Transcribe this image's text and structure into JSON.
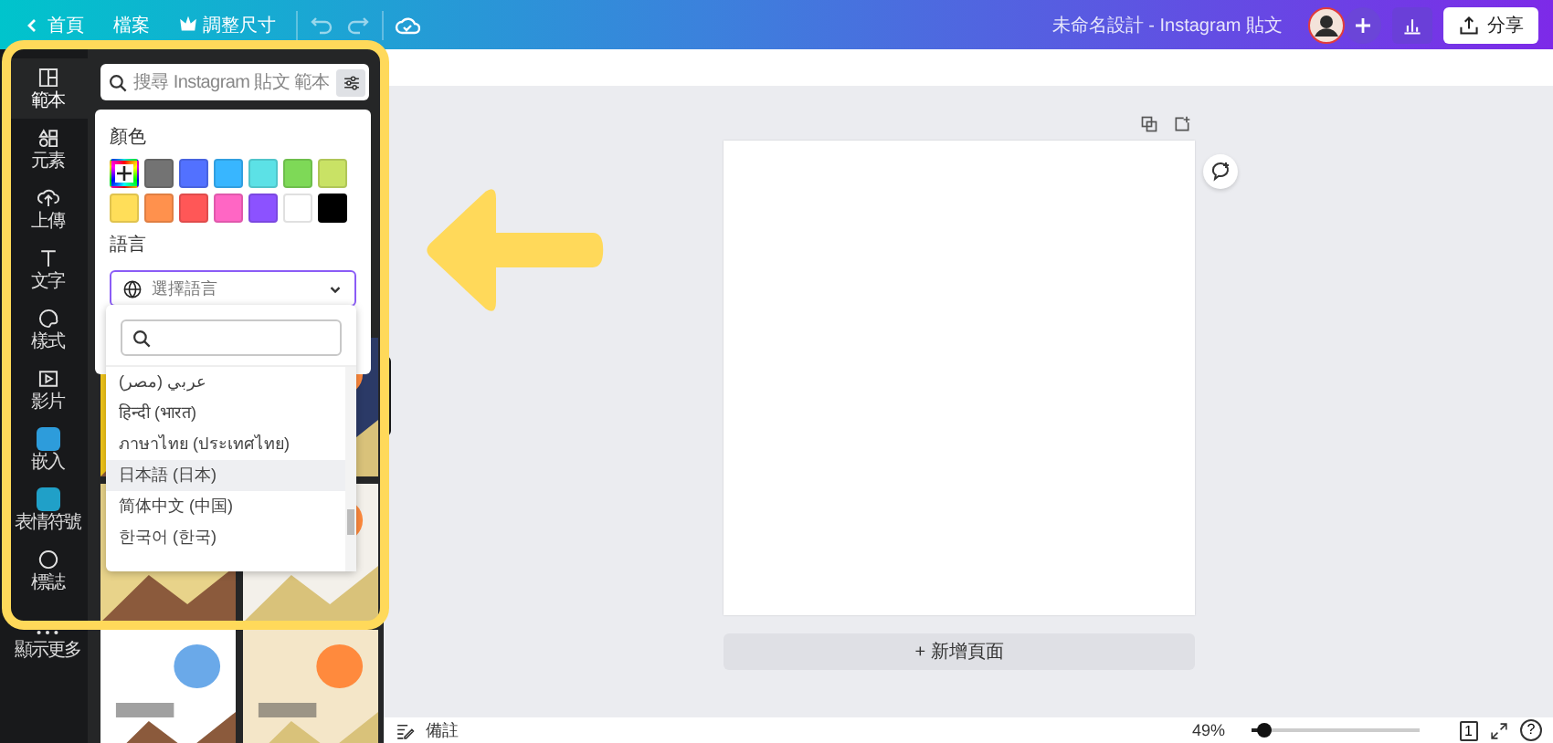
{
  "top_bar": {
    "home": "首頁",
    "file": "檔案",
    "resize": "調整尺寸",
    "title": "未命名設計 - Instagram 貼文",
    "share": "分享"
  },
  "sidebar": {
    "items": [
      {
        "label": "範本",
        "kind": "templates",
        "selected": true
      },
      {
        "label": "元素",
        "kind": "elements",
        "selected": false
      },
      {
        "label": "上傳",
        "kind": "uploads",
        "selected": false
      },
      {
        "label": "文字",
        "kind": "text",
        "selected": false
      },
      {
        "label": "樣式",
        "kind": "styles",
        "selected": false
      },
      {
        "label": "影片",
        "kind": "videos",
        "selected": false
      },
      {
        "label": "嵌入",
        "kind": "embed",
        "selected": false
      },
      {
        "label": "表情符號",
        "kind": "emoji",
        "selected": false
      },
      {
        "label": "標誌",
        "kind": "logo",
        "selected": false
      },
      {
        "label": "顯示更多",
        "kind": "more",
        "selected": false
      }
    ]
  },
  "panel": {
    "search": {
      "placeholder": "搜尋 Instagram 貼文 範本"
    }
  },
  "filter_popup": {
    "color_label": "顏色",
    "colors": [
      {
        "kind": "custom"
      },
      {
        "kind": "swatch",
        "color": "#737373"
      },
      {
        "kind": "swatch",
        "color": "#5271ff"
      },
      {
        "kind": "swatch",
        "color": "#38b6ff"
      },
      {
        "kind": "swatch",
        "color": "#5ce1e6"
      },
      {
        "kind": "swatch",
        "color": "#7ed957"
      },
      {
        "kind": "swatch",
        "color": "#c9e265"
      },
      {
        "kind": "swatch",
        "color": "#ffde59"
      },
      {
        "kind": "swatch",
        "color": "#ff914d"
      },
      {
        "kind": "swatch",
        "color": "#ff5757"
      },
      {
        "kind": "swatch",
        "color": "#ff66c4"
      },
      {
        "kind": "swatch",
        "color": "#8c52ff"
      },
      {
        "kind": "swatch",
        "color": "#ffffff"
      },
      {
        "kind": "swatch",
        "color": "#000000"
      }
    ],
    "language_label": "語言",
    "language_select": {
      "placeholder": "選擇語言"
    }
  },
  "language_dropdown": {
    "languages": [
      {
        "label": "عربي (مصر)",
        "selected": false
      },
      {
        "label": "हिन्दी (भारत)",
        "selected": false
      },
      {
        "label": "ภาษาไทย (ประเทศไทย)",
        "selected": false
      },
      {
        "label": "日本語 (日本)",
        "selected": true
      },
      {
        "label": "简体中文 (中国)",
        "selected": false
      },
      {
        "label": "한국어 (한국)",
        "selected": false
      }
    ]
  },
  "canvas": {
    "add_page": "+ 新增頁面"
  },
  "bottom_bar": {
    "notes": "備註",
    "zoom": "49%",
    "zoom_slider": {
      "level": 0.08
    },
    "page_count": "1",
    "help": "?"
  }
}
